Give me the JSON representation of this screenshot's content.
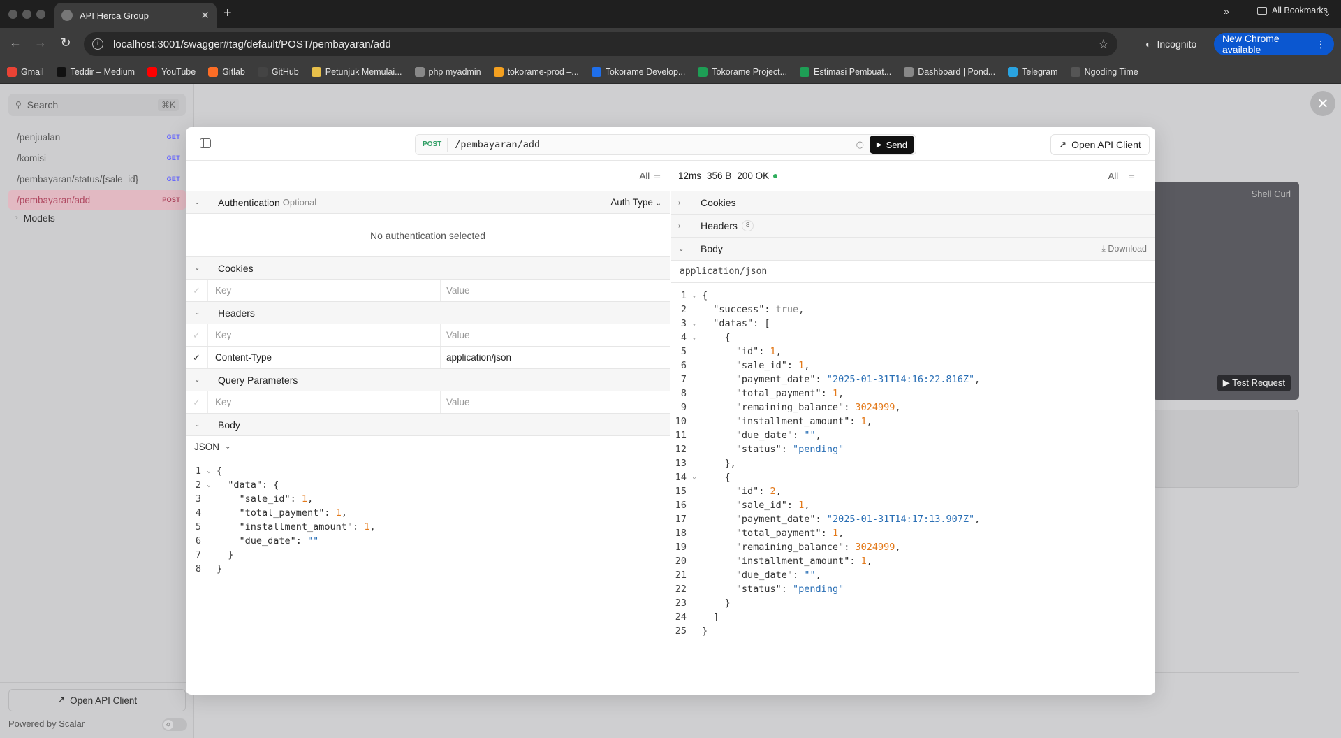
{
  "browser": {
    "tab_title": "API Herca Group",
    "url": "localhost:3001/swagger#tag/default/POST/pembayaran/add",
    "incognito_label": "Incognito",
    "update_label": "New Chrome available",
    "bookmarks": [
      {
        "label": "Gmail",
        "color": "#ea4335"
      },
      {
        "label": "Teddir – Medium",
        "color": "#111111"
      },
      {
        "label": "YouTube",
        "color": "#ff0000"
      },
      {
        "label": "Gitlab",
        "color": "#fc6d26"
      },
      {
        "label": "GitHub",
        "color": "#444444"
      },
      {
        "label": "Petunjuk Memulai...",
        "color": "#e8c04a"
      },
      {
        "label": "php myadmin",
        "color": "#888888"
      },
      {
        "label": "tokorame-prod –...",
        "color": "#f4a020"
      },
      {
        "label": "Tokorame Develop...",
        "color": "#1f6feb"
      },
      {
        "label": "Tokorame Project...",
        "color": "#1e9e55"
      },
      {
        "label": "Estimasi Pembuat...",
        "color": "#1e9e55"
      },
      {
        "label": "Dashboard | Pond...",
        "color": "#888888"
      },
      {
        "label": "Telegram",
        "color": "#2aa3e0"
      },
      {
        "label": "Ngoding Time",
        "color": "#555555"
      }
    ],
    "all_bookmarks_label": "All Bookmarks"
  },
  "sidebar": {
    "search_placeholder": "Search",
    "search_shortcut": "⌘K",
    "items": [
      {
        "label": "/penjualan",
        "method": "GET"
      },
      {
        "label": "/komisi",
        "method": "GET"
      },
      {
        "label": "/pembayaran/status/{sale_id}",
        "method": "GET"
      },
      {
        "label": "/pembayaran/add",
        "method": "POST"
      }
    ],
    "models_label": "Models",
    "open_client_label": "Open API Client",
    "powered_label": "Powered by Scalar"
  },
  "background": {
    "shell_label": "Shell Curl",
    "test_label": "Test Request"
  },
  "modal": {
    "method": "POST",
    "path": "/pembayaran/add",
    "send_label": "Send",
    "open_api_client_label": "Open API Client",
    "request": {
      "filter_label": "All",
      "auth_title": "Authentication",
      "auth_optional": "Optional",
      "auth_type_label": "Auth Type",
      "no_auth_text": "No authentication selected",
      "cookies_title": "Cookies",
      "headers_title": "Headers",
      "query_title": "Query Parameters",
      "body_title": "Body",
      "key_placeholder": "Key",
      "value_placeholder": "Value",
      "header_rows": [
        {
          "key": "Content-Type",
          "value": "application/json"
        }
      ],
      "body_format": "JSON"
    },
    "response": {
      "time": "12ms",
      "size": "356 B",
      "status": "200 OK",
      "filter_label": "All",
      "cookies_title": "Cookies",
      "headers_title": "Headers",
      "headers_count": "8",
      "body_title": "Body",
      "download_label": "Download",
      "content_type": "application/json"
    }
  },
  "request_body_lines": [
    [
      [
        "p",
        "{"
      ]
    ],
    [
      [
        "p",
        "  "
      ],
      [
        "p",
        "\"data\": {"
      ]
    ],
    [
      [
        "p",
        "    \"sale_id\": "
      ],
      [
        "n",
        "1"
      ],
      [
        "p",
        ","
      ]
    ],
    [
      [
        "p",
        "    \"total_payment\": "
      ],
      [
        "n",
        "1"
      ],
      [
        "p",
        ","
      ]
    ],
    [
      [
        "p",
        "    \"installment_amount\": "
      ],
      [
        "n",
        "1"
      ],
      [
        "p",
        ","
      ]
    ],
    [
      [
        "p",
        "    \"due_date\": "
      ],
      [
        "s",
        "\"\""
      ]
    ],
    [
      [
        "p",
        "  }"
      ]
    ],
    [
      [
        "p",
        "}"
      ]
    ]
  ],
  "request_fold_lines": [
    1,
    2
  ],
  "response_body_lines": [
    [
      [
        "p",
        "{"
      ]
    ],
    [
      [
        "p",
        "  \"success\": "
      ],
      [
        "k",
        "true"
      ],
      [
        "p",
        ","
      ]
    ],
    [
      [
        "p",
        "  \"datas\": ["
      ]
    ],
    [
      [
        "p",
        "    {"
      ]
    ],
    [
      [
        "p",
        "      \"id\": "
      ],
      [
        "n",
        "1"
      ],
      [
        "p",
        ","
      ]
    ],
    [
      [
        "p",
        "      \"sale_id\": "
      ],
      [
        "n",
        "1"
      ],
      [
        "p",
        ","
      ]
    ],
    [
      [
        "p",
        "      \"payment_date\": "
      ],
      [
        "s",
        "\"2025-01-31T14:16:22.816Z\""
      ],
      [
        "p",
        ","
      ]
    ],
    [
      [
        "p",
        "      \"total_payment\": "
      ],
      [
        "n",
        "1"
      ],
      [
        "p",
        ","
      ]
    ],
    [
      [
        "p",
        "      \"remaining_balance\": "
      ],
      [
        "n",
        "3024999"
      ],
      [
        "p",
        ","
      ]
    ],
    [
      [
        "p",
        "      \"installment_amount\": "
      ],
      [
        "n",
        "1"
      ],
      [
        "p",
        ","
      ]
    ],
    [
      [
        "p",
        "      \"due_date\": "
      ],
      [
        "s",
        "\"\""
      ],
      [
        "p",
        ","
      ]
    ],
    [
      [
        "p",
        "      \"status\": "
      ],
      [
        "s",
        "\"pending\""
      ]
    ],
    [
      [
        "p",
        "    },"
      ]
    ],
    [
      [
        "p",
        "    {"
      ]
    ],
    [
      [
        "p",
        "      \"id\": "
      ],
      [
        "n",
        "2"
      ],
      [
        "p",
        ","
      ]
    ],
    [
      [
        "p",
        "      \"sale_id\": "
      ],
      [
        "n",
        "1"
      ],
      [
        "p",
        ","
      ]
    ],
    [
      [
        "p",
        "      \"payment_date\": "
      ],
      [
        "s",
        "\"2025-01-31T14:17:13.907Z\""
      ],
      [
        "p",
        ","
      ]
    ],
    [
      [
        "p",
        "      \"total_payment\": "
      ],
      [
        "n",
        "1"
      ],
      [
        "p",
        ","
      ]
    ],
    [
      [
        "p",
        "      \"remaining_balance\": "
      ],
      [
        "n",
        "3024999"
      ],
      [
        "p",
        ","
      ]
    ],
    [
      [
        "p",
        "      \"installment_amount\": "
      ],
      [
        "n",
        "1"
      ],
      [
        "p",
        ","
      ]
    ],
    [
      [
        "p",
        "      \"due_date\": "
      ],
      [
        "s",
        "\"\""
      ],
      [
        "p",
        ","
      ]
    ],
    [
      [
        "p",
        "      \"status\": "
      ],
      [
        "s",
        "\"pending\""
      ]
    ],
    [
      [
        "p",
        "    }"
      ]
    ],
    [
      [
        "p",
        "  ]"
      ]
    ],
    [
      [
        "p",
        "}"
      ]
    ]
  ],
  "response_fold_lines": [
    1,
    3,
    4,
    14
  ]
}
